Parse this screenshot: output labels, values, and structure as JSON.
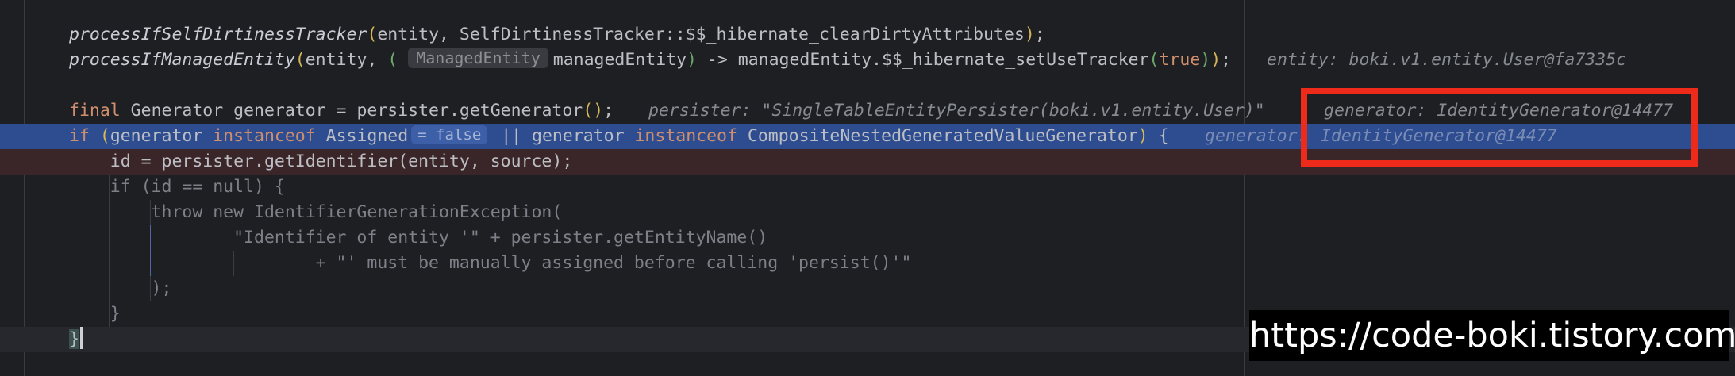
{
  "code": {
    "line1": {
      "fn": "processIfSelfDirtinessTracker",
      "open": "(",
      "args": "entity, SelfDirtinessTracker::$$_hibernate_clearDirtyAttributes",
      "close": ")",
      "semi": ";"
    },
    "line2": {
      "fn": "processIfManagedEntity",
      "open": "(",
      "args_start": "entity, ",
      "lambda_open": "(",
      "type_hint": "ManagedEntity",
      "param": "managedEntity",
      "lambda_close": ")",
      "arrow": " -> managedEntity.$$_hibernate_setUseTracker",
      "inner_open": "(",
      "true_kw": "true",
      "inner_close": ")",
      "outer_close": ")",
      "semi": ";",
      "debug_value": "entity: boki.v1.entity.User@fa7335c"
    },
    "line3": {
      "kw": "final",
      "text": " Generator generator = persister.getGenerator",
      "parens": "()",
      "semi": ";",
      "debug_value_persister": "persister: \"SingleTableEntityPersister(boki.v1.entity.User)\"",
      "debug_value_generator": "generator: IdentityGenerator@14477"
    },
    "line4": {
      "kw_if": "if",
      "open": " (",
      "var1": "generator ",
      "kw_instanceof1": "instanceof",
      "type1": " Assigned",
      "hint_false": "= false",
      "or": " || generator ",
      "kw_instanceof2": "instanceof",
      "type2": " CompositeNestedGeneratedValueGenerator",
      "close": ")",
      "brace": " {",
      "debug_value_label": "generator:",
      "debug_value": "IdentityGenerator@14477"
    },
    "line5": "    id = persister.getIdentifier(entity, source);",
    "line6": "    if (id == null) {",
    "line7": "        throw new IdentifierGenerationException(",
    "line8": "                \"Identifier of entity '\" + persister.getEntityName()",
    "line9": "                        + \"' must be manually assigned before calling 'persist()'\"",
    "line10": "        );",
    "line11": "    }",
    "line12": "}"
  },
  "watermark": "https://code-boki.tistory.com",
  "colors": {
    "background": "#1e1f22",
    "execution_line": "#2e4d91",
    "breakpoint_line": "#3a2528",
    "annotation_box": "#ee2b1a",
    "keyword": "#cf8e6d",
    "function_call": "#56a8f5"
  }
}
